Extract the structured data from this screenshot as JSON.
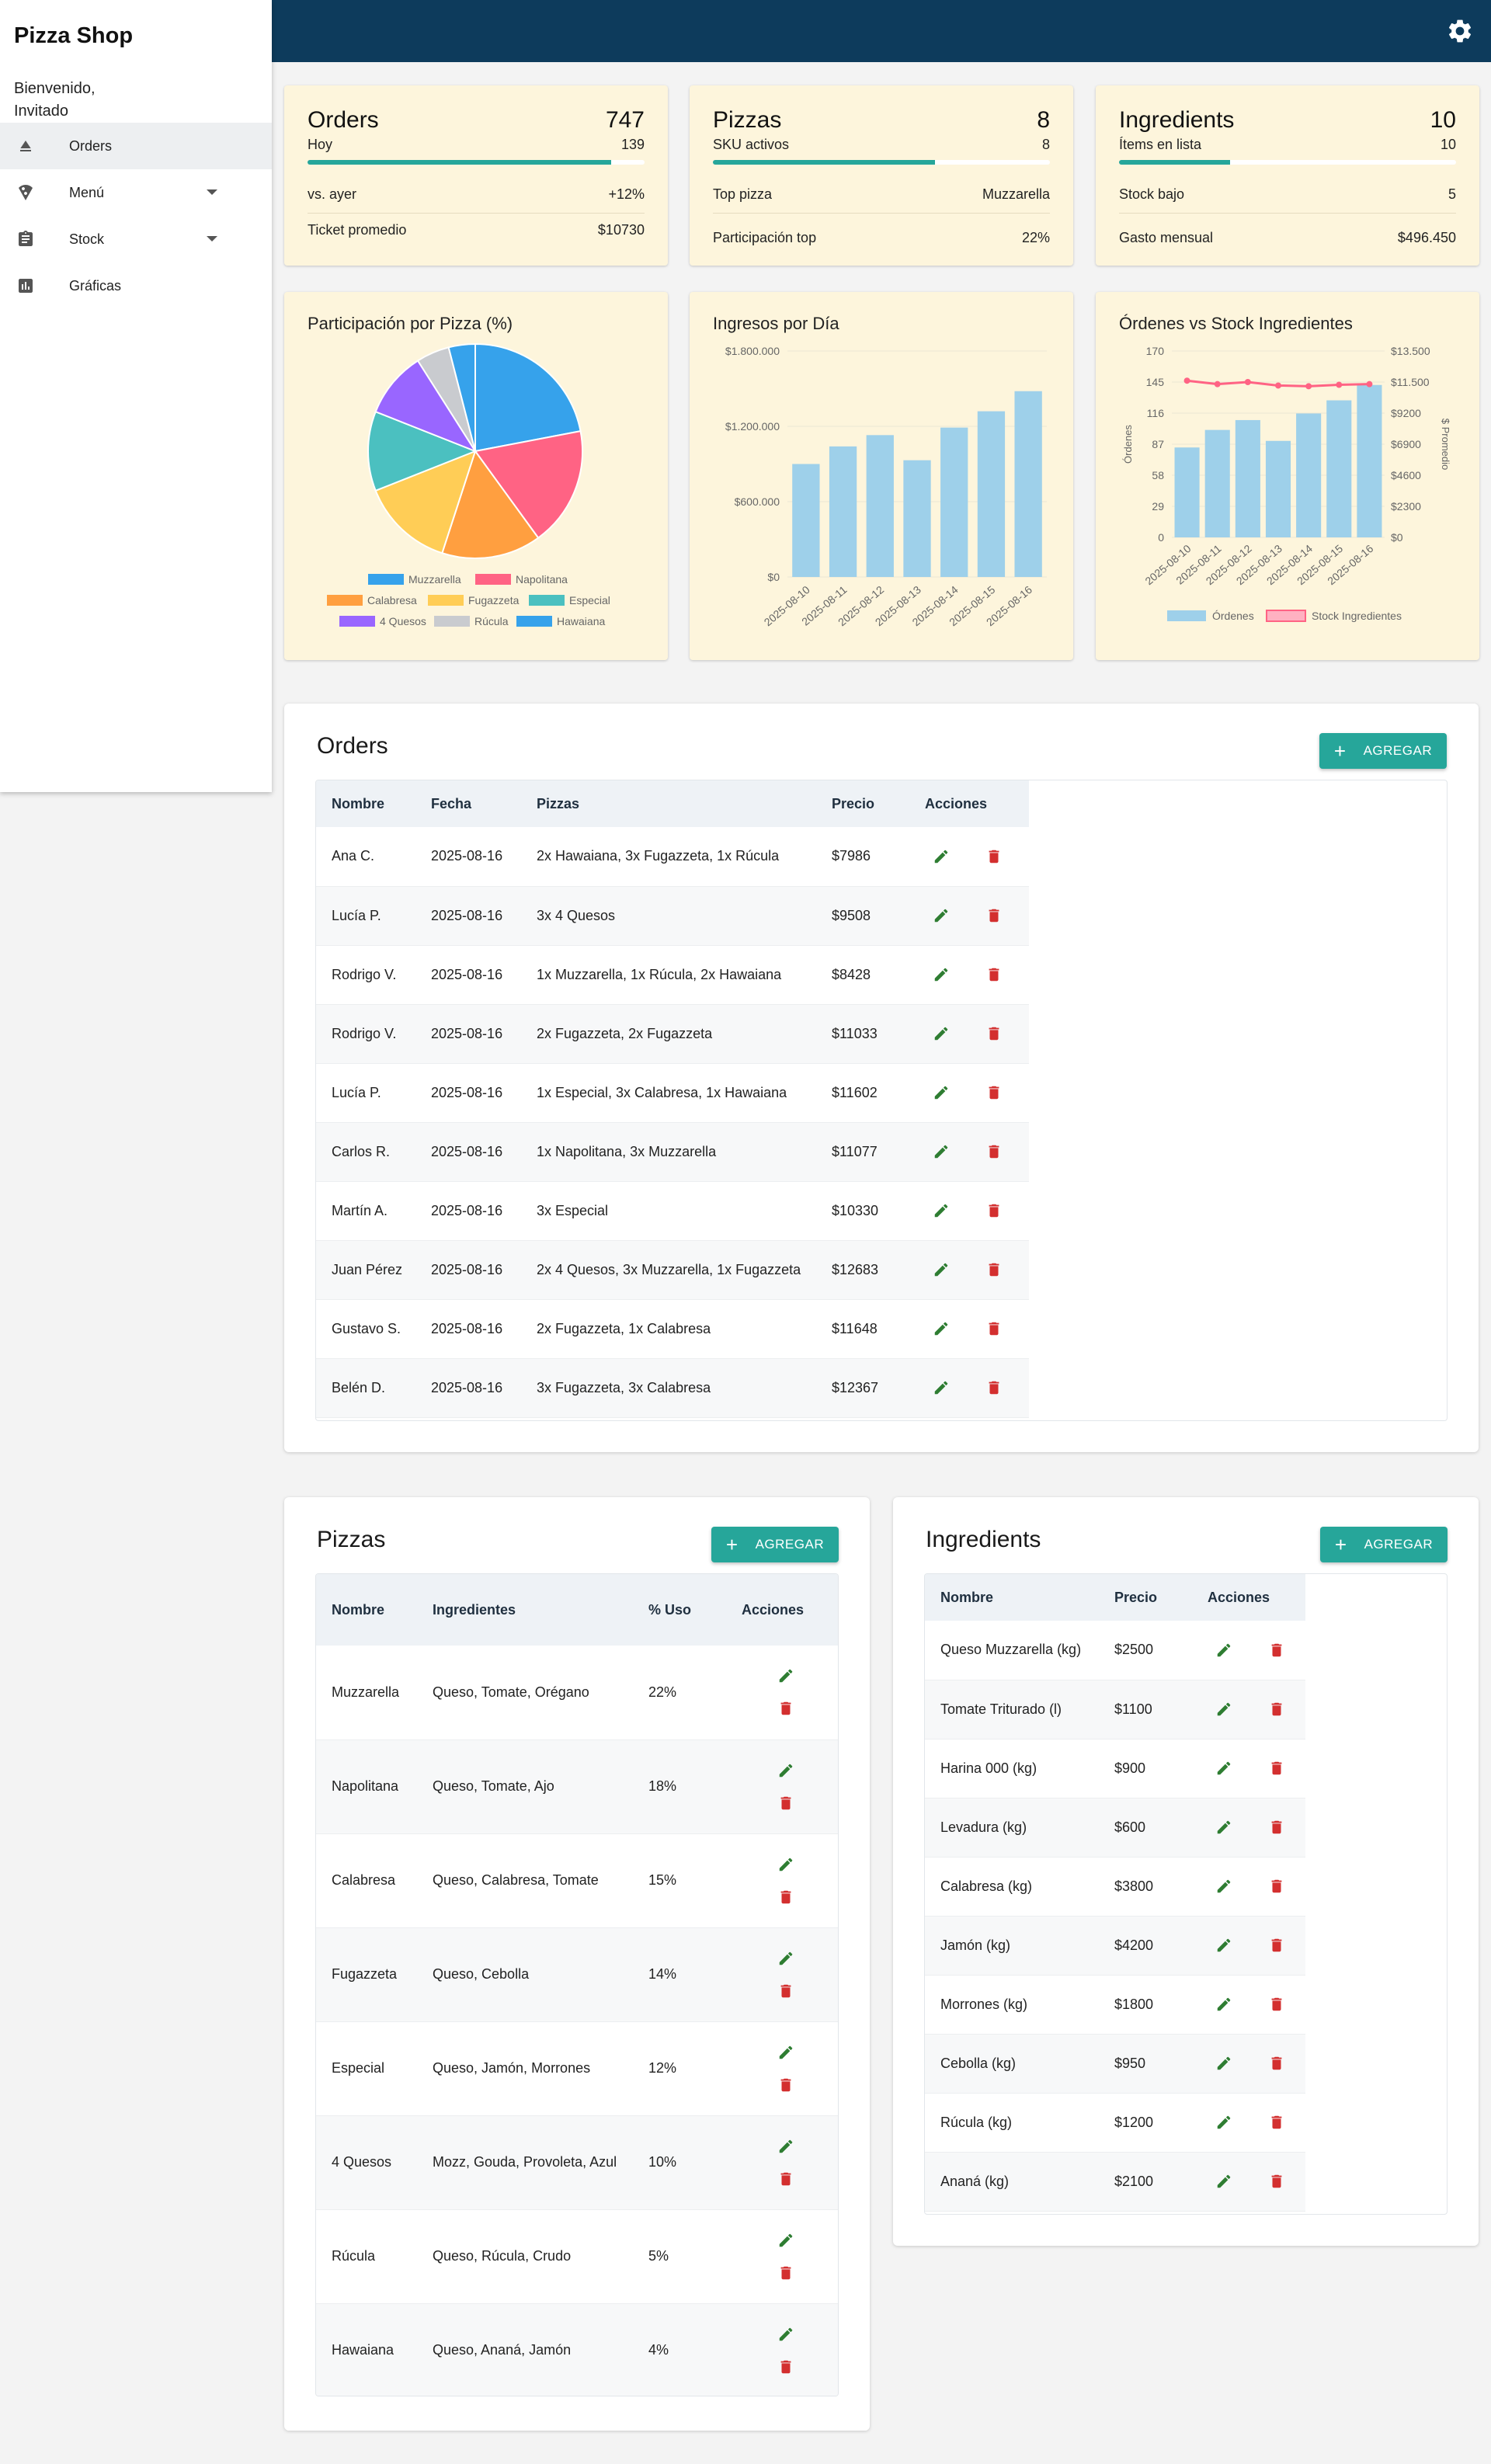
{
  "brand": "Pizza Shop",
  "welcome": "Bienvenido, Invitado",
  "nav": [
    {
      "label": "Orders",
      "icon": "eject-icon",
      "active": true
    },
    {
      "label": "Menú",
      "icon": "pizza-icon",
      "dropdown": true
    },
    {
      "label": "Stock",
      "icon": "clipboard-icon",
      "dropdown": true
    },
    {
      "label": "Gráficas",
      "icon": "bar-chart-icon"
    }
  ],
  "kpis": [
    {
      "title": "Orders",
      "value": "747",
      "sub": "Hoy",
      "subv": "139",
      "progress": 0.9,
      "rows": [
        [
          "vs. ayer",
          "+12%"
        ],
        [
          "Ticket promedio",
          "$10730"
        ]
      ]
    },
    {
      "title": "Pizzas",
      "value": "8",
      "sub": "SKU activos",
      "subv": "8",
      "progress": 0.66,
      "rows": [
        [
          "Top pizza",
          "Muzzarella"
        ],
        [
          "Participación top",
          "22%"
        ]
      ]
    },
    {
      "title": "Ingredients",
      "value": "10",
      "sub": "Ítems en lista",
      "subv": "10",
      "progress": 0.33,
      "rows": [
        [
          "Stock bajo",
          "5"
        ],
        [
          "Gasto mensual",
          "$496.450"
        ]
      ]
    }
  ],
  "chart_data": [
    {
      "type": "pie",
      "title": "Participación por Pizza (%)",
      "categories": [
        "Muzzarella",
        "Napolitana",
        "Calabresa",
        "Fugazzeta",
        "Especial",
        "4 Quesos",
        "Rúcula",
        "Hawaiana"
      ],
      "values": [
        22,
        18,
        15,
        14,
        12,
        10,
        5,
        4
      ],
      "colors": [
        "#36a2eb",
        "#ff6384",
        "#ff9f40",
        "#ffcd56",
        "#4bc0c0",
        "#9966ff",
        "#c9cbcf",
        "#36a2eb"
      ],
      "legend": "bottom"
    },
    {
      "type": "bar",
      "title": "Ingresos por Día",
      "categories": [
        "2025-08-10",
        "2025-08-11",
        "2025-08-12",
        "2025-08-13",
        "2025-08-14",
        "2025-08-15",
        "2025-08-16"
      ],
      "values": [
        900000,
        1040000,
        1130000,
        930000,
        1190000,
        1320000,
        1480000
      ],
      "ylim": [
        0,
        1800000
      ],
      "yticks": [
        "$0",
        "$600.000",
        "$1.200.000",
        "$1.800.000"
      ],
      "color": "#9ed0ea"
    },
    {
      "type": "bar",
      "title": "Órdenes vs Stock Ingredientes",
      "categories": [
        "2025-08-10",
        "2025-08-11",
        "2025-08-12",
        "2025-08-13",
        "2025-08-14",
        "2025-08-15",
        "2025-08-16"
      ],
      "series": [
        {
          "name": "Órdenes",
          "type": "bar",
          "values": [
            82,
            98,
            107,
            88,
            113,
            125,
            139
          ],
          "color": "#9ed0ea"
        },
        {
          "name": "Stock Ingredientes",
          "type": "line",
          "values": [
            11350,
            11100,
            11250,
            11000,
            10950,
            11050,
            11100
          ],
          "color": "#ff6384"
        }
      ],
      "ylabel": "Órdenes",
      "y2label": "$ Promedio",
      "ylim": [
        0,
        170
      ],
      "y2lim": [
        0,
        13500
      ],
      "yticks": [
        "0",
        "29",
        "58",
        "87",
        "116",
        "145",
        "170"
      ],
      "y2ticks": [
        "$0",
        "$2300",
        "$4600",
        "$6900",
        "$9200",
        "$11.500",
        "$13.500"
      ]
    }
  ],
  "orders": {
    "title": "Orders",
    "add_label": "AGREGAR",
    "headers": [
      "Nombre",
      "Fecha",
      "Pizzas",
      "Precio",
      "Acciones"
    ],
    "rows": [
      [
        "Ana C.",
        "2025-08-16",
        "2x Hawaiana, 3x Fugazzeta, 1x Rúcula",
        "$7986"
      ],
      [
        "Lucía P.",
        "2025-08-16",
        "3x 4 Quesos",
        "$9508"
      ],
      [
        "Rodrigo V.",
        "2025-08-16",
        "1x Muzzarella, 1x Rúcula, 2x Hawaiana",
        "$8428"
      ],
      [
        "Rodrigo V.",
        "2025-08-16",
        "2x Fugazzeta, 2x Fugazzeta",
        "$11033"
      ],
      [
        "Lucía P.",
        "2025-08-16",
        "1x Especial, 3x Calabresa, 1x Hawaiana",
        "$11602"
      ],
      [
        "Carlos R.",
        "2025-08-16",
        "1x Napolitana, 3x Muzzarella",
        "$11077"
      ],
      [
        "Martín A.",
        "2025-08-16",
        "3x Especial",
        "$10330"
      ],
      [
        "Juan Pérez",
        "2025-08-16",
        "2x 4 Quesos, 3x Muzzarella, 1x Fugazzeta",
        "$12683"
      ],
      [
        "Gustavo S.",
        "2025-08-16",
        "2x Fugazzeta, 1x Calabresa",
        "$11648"
      ],
      [
        "Belén D.",
        "2025-08-16",
        "3x Fugazzeta, 3x Calabresa",
        "$12367"
      ]
    ]
  },
  "pizzas": {
    "title": "Pizzas",
    "add_label": "AGREGAR",
    "headers": [
      "Nombre",
      "Ingredientes",
      "% Uso",
      "Acciones"
    ],
    "rows": [
      [
        "Muzzarella",
        "Queso, Tomate, Orégano",
        "22%"
      ],
      [
        "Napolitana",
        "Queso, Tomate, Ajo",
        "18%"
      ],
      [
        "Calabresa",
        "Queso, Calabresa, Tomate",
        "15%"
      ],
      [
        "Fugazzeta",
        "Queso, Cebolla",
        "14%"
      ],
      [
        "Especial",
        "Queso, Jamón, Morrones",
        "12%"
      ],
      [
        "4 Quesos",
        "Mozz, Gouda, Provoleta, Azul",
        "10%"
      ],
      [
        "Rúcula",
        "Queso, Rúcula, Crudo",
        "5%"
      ],
      [
        "Hawaiana",
        "Queso, Ananá, Jamón",
        "4%"
      ]
    ]
  },
  "ingredients": {
    "title": "Ingredients",
    "add_label": "AGREGAR",
    "headers": [
      "Nombre",
      "Precio",
      "Acciones"
    ],
    "rows": [
      [
        "Queso Muzzarella (kg)",
        "$2500"
      ],
      [
        "Tomate Triturado (l)",
        "$1100"
      ],
      [
        "Harina 000 (kg)",
        "$900"
      ],
      [
        "Levadura (kg)",
        "$600"
      ],
      [
        "Calabresa (kg)",
        "$3800"
      ],
      [
        "Jamón (kg)",
        "$4200"
      ],
      [
        "Morrones (kg)",
        "$1800"
      ],
      [
        "Cebolla (kg)",
        "$950"
      ],
      [
        "Rúcula (kg)",
        "$1200"
      ],
      [
        "Ananá (kg)",
        "$2100"
      ]
    ]
  },
  "colors": {
    "accent": "#26a69a",
    "topbar": "#0d3b5c",
    "card": "#fdf5dc",
    "edit": "#2e7d32",
    "delete": "#d32f2f"
  }
}
